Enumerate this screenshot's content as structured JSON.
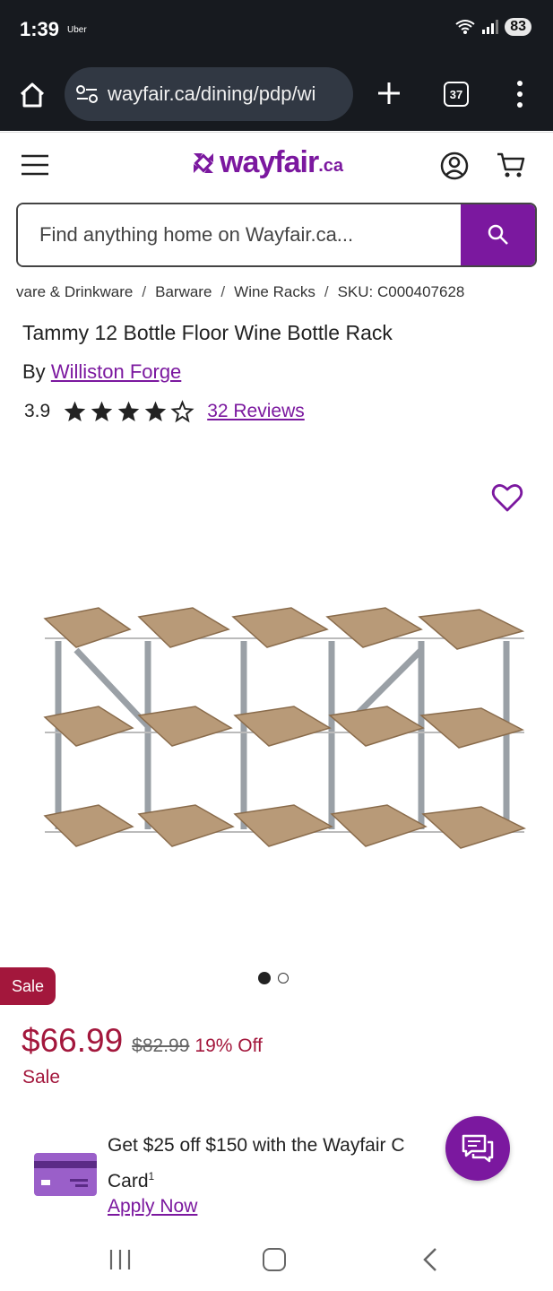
{
  "status_bar": {
    "time": "1:39",
    "app": "Uber",
    "battery": "83"
  },
  "browser": {
    "url": "wayfair.ca/dining/pdp/wi",
    "tab_count": "37"
  },
  "site": {
    "logo_word": "wayfair",
    "logo_suffix": ".ca",
    "brand_color": "#7b189f"
  },
  "search": {
    "placeholder": "Find anything home on Wayfair.ca..."
  },
  "breadcrumbs": [
    "vare & Drinkware",
    "Barware",
    "Wine Racks",
    "SKU: C000407628"
  ],
  "breadcrumb_separator": "/",
  "product": {
    "title": "Tammy 12 Bottle Floor Wine Bottle Rack",
    "by_label": "By",
    "brand": "Williston Forge",
    "rating": "3.9",
    "stars": {
      "filled": 4,
      "total": 5
    },
    "reviews_label": "32 Reviews"
  },
  "gallery": {
    "image_count": 2,
    "active_index": 0
  },
  "pricing": {
    "sale_tag": "Sale",
    "price": "$66.99",
    "original_price": "$82.99",
    "discount": "19% Off",
    "sale_label": "Sale",
    "sale_color": "#a3173c"
  },
  "promo": {
    "text_line1": "Get $25 off $150 with the Wayfair C",
    "text_line2": "Card",
    "footnote": "1",
    "link": "Apply Now"
  },
  "icons": [
    "home-icon",
    "site-settings-icon",
    "plus-icon",
    "tabs-icon",
    "more-icon",
    "menu-icon",
    "account-icon",
    "cart-icon",
    "search-icon",
    "star-icon",
    "heart-icon",
    "credit-card-icon",
    "chat-icon",
    "recents-icon",
    "nav-home-icon",
    "back-icon"
  ]
}
